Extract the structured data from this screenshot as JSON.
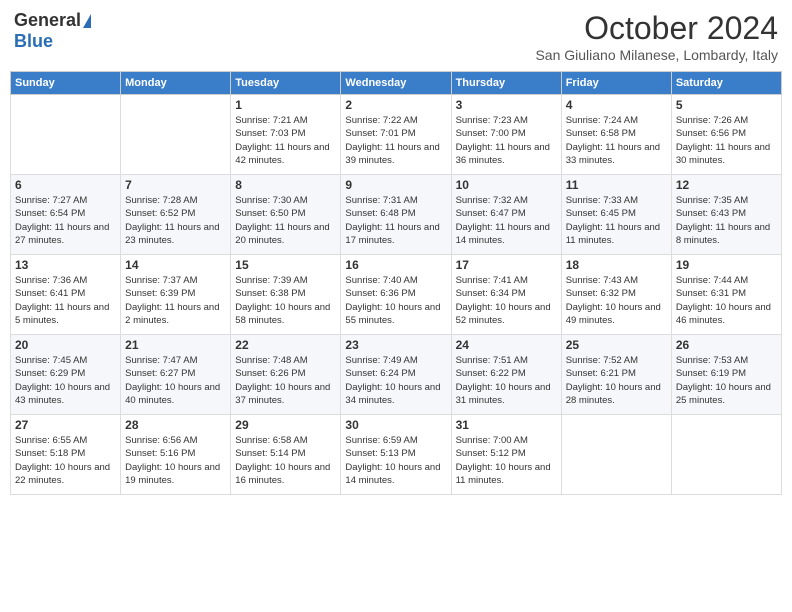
{
  "header": {
    "logo_general": "General",
    "logo_blue": "Blue",
    "month": "October 2024",
    "location": "San Giuliano Milanese, Lombardy, Italy"
  },
  "weekdays": [
    "Sunday",
    "Monday",
    "Tuesday",
    "Wednesday",
    "Thursday",
    "Friday",
    "Saturday"
  ],
  "weeks": [
    [
      {
        "day": "",
        "sunrise": "",
        "sunset": "",
        "daylight": ""
      },
      {
        "day": "",
        "sunrise": "",
        "sunset": "",
        "daylight": ""
      },
      {
        "day": "1",
        "sunrise": "Sunrise: 7:21 AM",
        "sunset": "Sunset: 7:03 PM",
        "daylight": "Daylight: 11 hours and 42 minutes."
      },
      {
        "day": "2",
        "sunrise": "Sunrise: 7:22 AM",
        "sunset": "Sunset: 7:01 PM",
        "daylight": "Daylight: 11 hours and 39 minutes."
      },
      {
        "day": "3",
        "sunrise": "Sunrise: 7:23 AM",
        "sunset": "Sunset: 7:00 PM",
        "daylight": "Daylight: 11 hours and 36 minutes."
      },
      {
        "day": "4",
        "sunrise": "Sunrise: 7:24 AM",
        "sunset": "Sunset: 6:58 PM",
        "daylight": "Daylight: 11 hours and 33 minutes."
      },
      {
        "day": "5",
        "sunrise": "Sunrise: 7:26 AM",
        "sunset": "Sunset: 6:56 PM",
        "daylight": "Daylight: 11 hours and 30 minutes."
      }
    ],
    [
      {
        "day": "6",
        "sunrise": "Sunrise: 7:27 AM",
        "sunset": "Sunset: 6:54 PM",
        "daylight": "Daylight: 11 hours and 27 minutes."
      },
      {
        "day": "7",
        "sunrise": "Sunrise: 7:28 AM",
        "sunset": "Sunset: 6:52 PM",
        "daylight": "Daylight: 11 hours and 23 minutes."
      },
      {
        "day": "8",
        "sunrise": "Sunrise: 7:30 AM",
        "sunset": "Sunset: 6:50 PM",
        "daylight": "Daylight: 11 hours and 20 minutes."
      },
      {
        "day": "9",
        "sunrise": "Sunrise: 7:31 AM",
        "sunset": "Sunset: 6:48 PM",
        "daylight": "Daylight: 11 hours and 17 minutes."
      },
      {
        "day": "10",
        "sunrise": "Sunrise: 7:32 AM",
        "sunset": "Sunset: 6:47 PM",
        "daylight": "Daylight: 11 hours and 14 minutes."
      },
      {
        "day": "11",
        "sunrise": "Sunrise: 7:33 AM",
        "sunset": "Sunset: 6:45 PM",
        "daylight": "Daylight: 11 hours and 11 minutes."
      },
      {
        "day": "12",
        "sunrise": "Sunrise: 7:35 AM",
        "sunset": "Sunset: 6:43 PM",
        "daylight": "Daylight: 11 hours and 8 minutes."
      }
    ],
    [
      {
        "day": "13",
        "sunrise": "Sunrise: 7:36 AM",
        "sunset": "Sunset: 6:41 PM",
        "daylight": "Daylight: 11 hours and 5 minutes."
      },
      {
        "day": "14",
        "sunrise": "Sunrise: 7:37 AM",
        "sunset": "Sunset: 6:39 PM",
        "daylight": "Daylight: 11 hours and 2 minutes."
      },
      {
        "day": "15",
        "sunrise": "Sunrise: 7:39 AM",
        "sunset": "Sunset: 6:38 PM",
        "daylight": "Daylight: 10 hours and 58 minutes."
      },
      {
        "day": "16",
        "sunrise": "Sunrise: 7:40 AM",
        "sunset": "Sunset: 6:36 PM",
        "daylight": "Daylight: 10 hours and 55 minutes."
      },
      {
        "day": "17",
        "sunrise": "Sunrise: 7:41 AM",
        "sunset": "Sunset: 6:34 PM",
        "daylight": "Daylight: 10 hours and 52 minutes."
      },
      {
        "day": "18",
        "sunrise": "Sunrise: 7:43 AM",
        "sunset": "Sunset: 6:32 PM",
        "daylight": "Daylight: 10 hours and 49 minutes."
      },
      {
        "day": "19",
        "sunrise": "Sunrise: 7:44 AM",
        "sunset": "Sunset: 6:31 PM",
        "daylight": "Daylight: 10 hours and 46 minutes."
      }
    ],
    [
      {
        "day": "20",
        "sunrise": "Sunrise: 7:45 AM",
        "sunset": "Sunset: 6:29 PM",
        "daylight": "Daylight: 10 hours and 43 minutes."
      },
      {
        "day": "21",
        "sunrise": "Sunrise: 7:47 AM",
        "sunset": "Sunset: 6:27 PM",
        "daylight": "Daylight: 10 hours and 40 minutes."
      },
      {
        "day": "22",
        "sunrise": "Sunrise: 7:48 AM",
        "sunset": "Sunset: 6:26 PM",
        "daylight": "Daylight: 10 hours and 37 minutes."
      },
      {
        "day": "23",
        "sunrise": "Sunrise: 7:49 AM",
        "sunset": "Sunset: 6:24 PM",
        "daylight": "Daylight: 10 hours and 34 minutes."
      },
      {
        "day": "24",
        "sunrise": "Sunrise: 7:51 AM",
        "sunset": "Sunset: 6:22 PM",
        "daylight": "Daylight: 10 hours and 31 minutes."
      },
      {
        "day": "25",
        "sunrise": "Sunrise: 7:52 AM",
        "sunset": "Sunset: 6:21 PM",
        "daylight": "Daylight: 10 hours and 28 minutes."
      },
      {
        "day": "26",
        "sunrise": "Sunrise: 7:53 AM",
        "sunset": "Sunset: 6:19 PM",
        "daylight": "Daylight: 10 hours and 25 minutes."
      }
    ],
    [
      {
        "day": "27",
        "sunrise": "Sunrise: 6:55 AM",
        "sunset": "Sunset: 5:18 PM",
        "daylight": "Daylight: 10 hours and 22 minutes."
      },
      {
        "day": "28",
        "sunrise": "Sunrise: 6:56 AM",
        "sunset": "Sunset: 5:16 PM",
        "daylight": "Daylight: 10 hours and 19 minutes."
      },
      {
        "day": "29",
        "sunrise": "Sunrise: 6:58 AM",
        "sunset": "Sunset: 5:14 PM",
        "daylight": "Daylight: 10 hours and 16 minutes."
      },
      {
        "day": "30",
        "sunrise": "Sunrise: 6:59 AM",
        "sunset": "Sunset: 5:13 PM",
        "daylight": "Daylight: 10 hours and 14 minutes."
      },
      {
        "day": "31",
        "sunrise": "Sunrise: 7:00 AM",
        "sunset": "Sunset: 5:12 PM",
        "daylight": "Daylight: 10 hours and 11 minutes."
      },
      {
        "day": "",
        "sunrise": "",
        "sunset": "",
        "daylight": ""
      },
      {
        "day": "",
        "sunrise": "",
        "sunset": "",
        "daylight": ""
      }
    ]
  ]
}
